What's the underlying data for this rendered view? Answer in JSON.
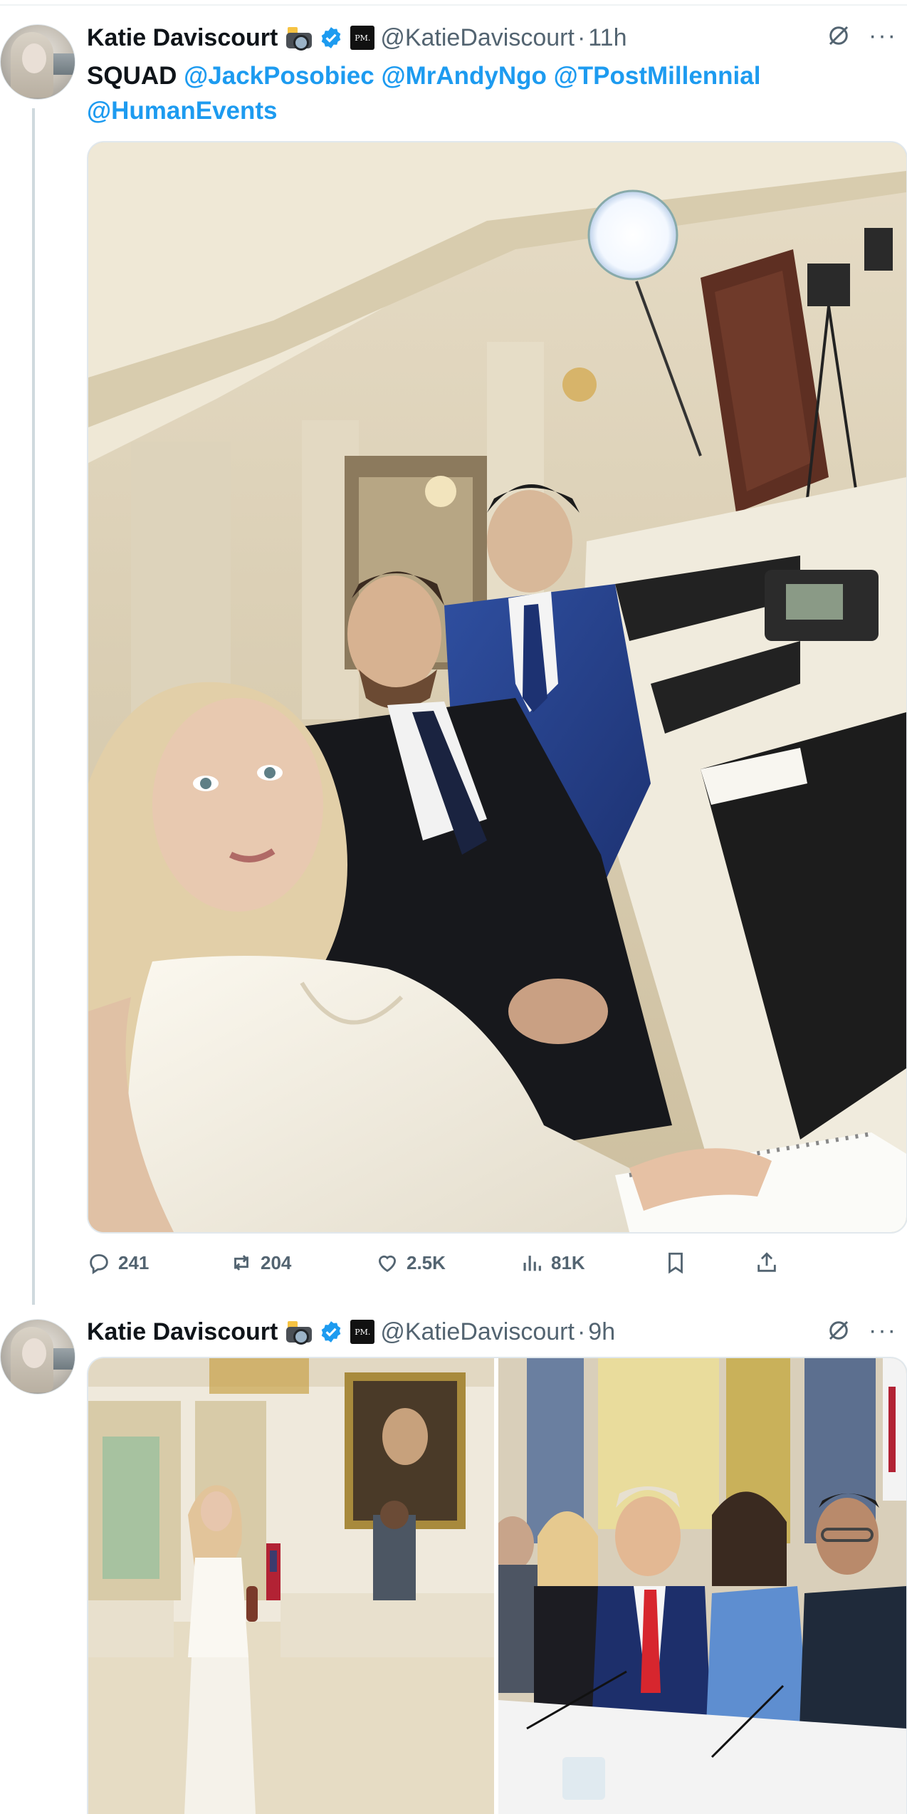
{
  "tweets": [
    {
      "author": "Katie Daviscourt",
      "handle": "@KatieDaviscourt",
      "time": "11h",
      "badge_text": "PM.",
      "text_word": "SQUAD",
      "mentions": [
        "@JackPosobiec",
        "@MrAndyNgo",
        "@TPostMillennial",
        "@HumanEvents"
      ],
      "media": "selfie-photo",
      "stats": {
        "replies": "241",
        "reposts": "204",
        "likes": "2.5K",
        "views": "81K"
      }
    },
    {
      "author": "Katie Daviscourt",
      "handle": "@KatieDaviscourt",
      "time": "9h",
      "badge_text": "PM.",
      "media": [
        "state-dining-room-photo",
        "cabinet-meeting-photo"
      ]
    }
  ],
  "icons": [
    "grok-icon",
    "more-icon",
    "reply-icon",
    "repost-icon",
    "like-icon",
    "views-icon",
    "bookmark-icon",
    "share-icon",
    "verified-icon",
    "camera-emoji-icon"
  ],
  "colors": {
    "link": "#1d9bf0",
    "secondary": "#536471",
    "text": "#0f1419",
    "verified": "#1d9bf0"
  }
}
